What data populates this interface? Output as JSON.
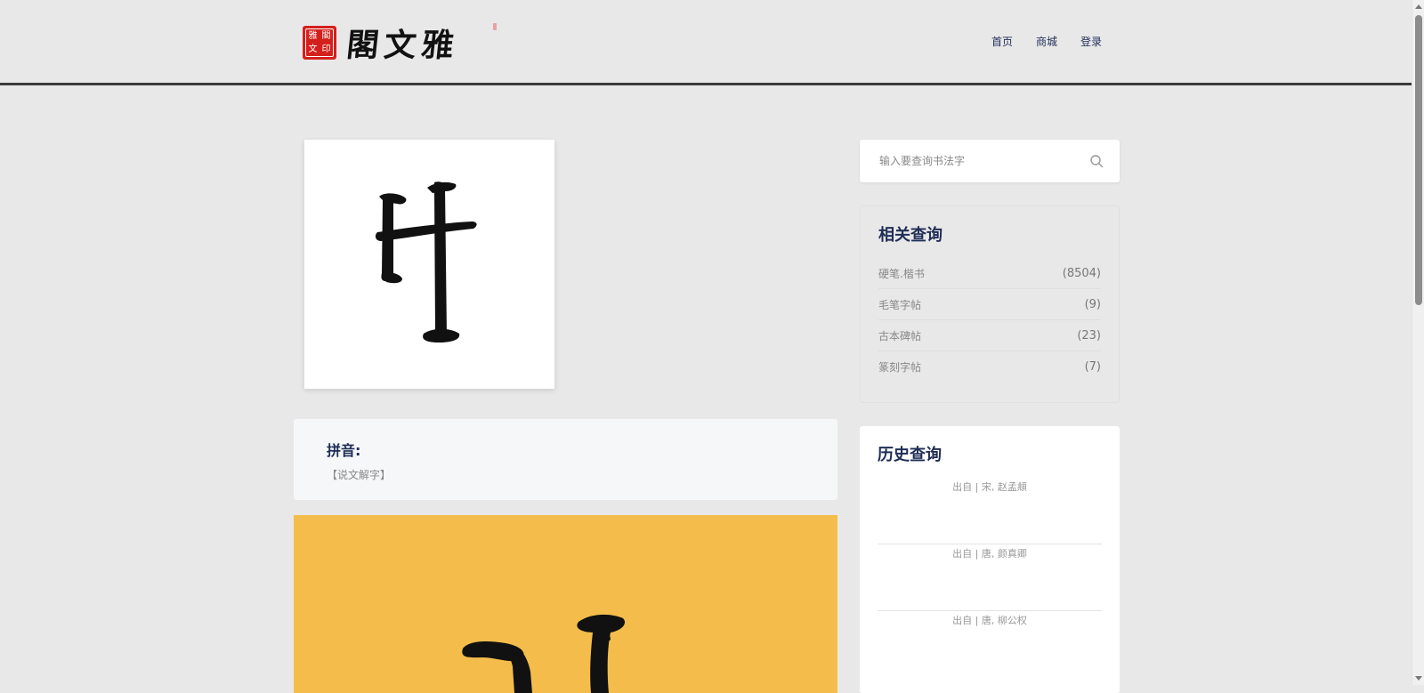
{
  "header": {
    "logo_text": "閣文雅",
    "seal_chars": [
      "雅",
      "閣",
      "文",
      "印"
    ],
    "nav": [
      {
        "label": "首页"
      },
      {
        "label": "商城"
      },
      {
        "label": "登录"
      }
    ]
  },
  "main": {
    "pinyin_title": "拼音:",
    "pinyin_source": "【说文解字】"
  },
  "sidebar": {
    "search_placeholder": "输入要查询书法字",
    "related_title": "相关查询",
    "related_items": [
      {
        "label": "硬笔.楷书",
        "count": "(8504)"
      },
      {
        "label": "毛笔字帖",
        "count": "(9)"
      },
      {
        "label": "古本碑帖",
        "count": "(23)"
      },
      {
        "label": "篆刻字帖",
        "count": "(7)"
      }
    ],
    "history_title": "历史查询",
    "history_items": [
      {
        "label": "出自 | 宋, 赵孟頫"
      },
      {
        "label": "出自 | 唐, 颜真卿"
      },
      {
        "label": "出自 | 唐, 柳公权"
      }
    ]
  },
  "colors": {
    "accent": "#1f2d56",
    "seal": "#d4201c",
    "yellow": "#f4bd4b",
    "background": "#e8e8e8"
  }
}
